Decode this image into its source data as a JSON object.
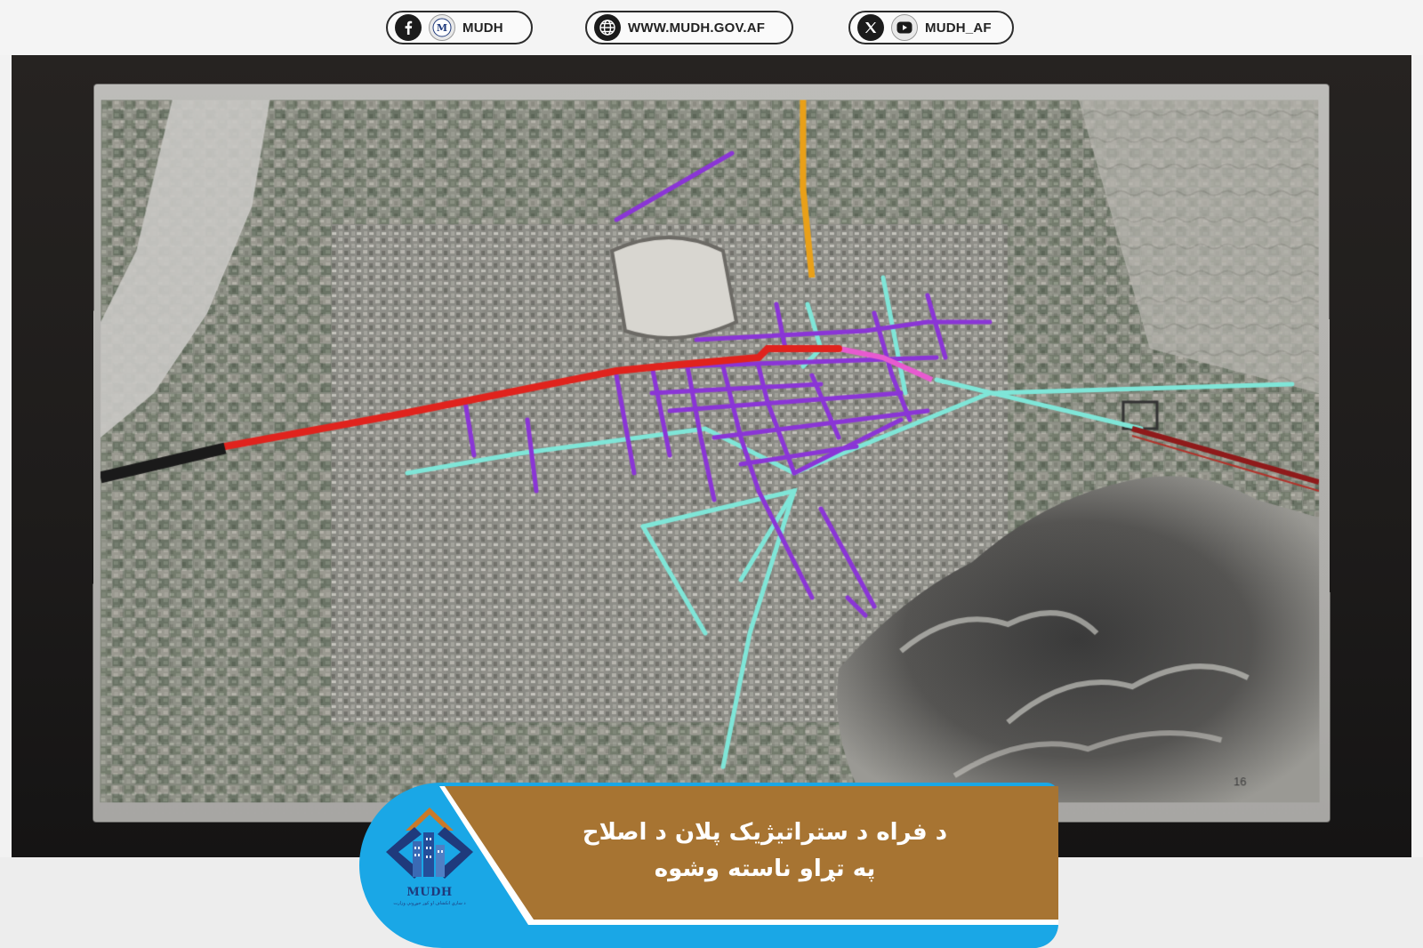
{
  "social_bar": {
    "facebook": {
      "icon": "facebook-icon",
      "secondary_icon": "mudh-logo-icon",
      "label": "MUDH"
    },
    "website": {
      "icon": "globe-icon",
      "label": "WWW.MUDH.GOV.AF"
    },
    "twitter": {
      "icon": "x-icon",
      "secondary_icon": "youtube-icon",
      "label": "MUDH_AF"
    }
  },
  "photo": {
    "screen_page_number": "16"
  },
  "banner": {
    "title_line1": "د فراه د ستراتیژیک پلان د اصلاح",
    "title_line2": "په تړاو ناسته وشوه"
  },
  "logo": {
    "name": "MUDH",
    "subtitle": "د ښاري انکشاف او کور جوړونې وزارت"
  },
  "colors": {
    "banner_brown": "#a77432",
    "banner_blue": "#1aa7e6",
    "logo_blue": "#1f3a7c",
    "logo_orange": "#c97a2a",
    "road_red": "#e0231d",
    "road_purple": "#8a35d6",
    "road_cyan": "#7fe6d8",
    "road_orange": "#e9a018",
    "road_pink": "#e85ad0"
  }
}
